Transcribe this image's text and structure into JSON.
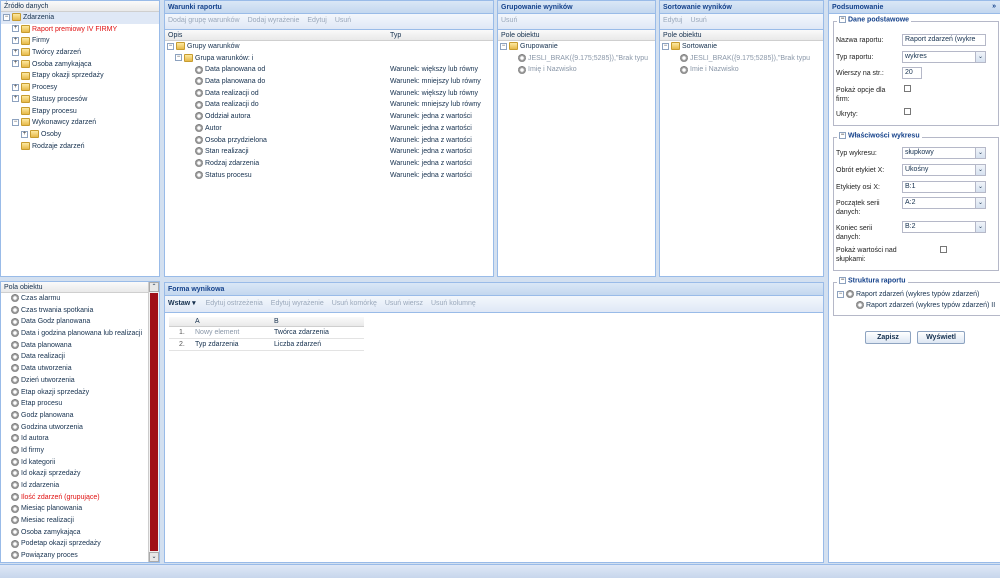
{
  "source": {
    "title": "Źródło danych",
    "items": [
      {
        "label": "Zdarzenia",
        "toggle": "−",
        "indent": 0,
        "selected": true
      },
      {
        "label": "Raport premiowy IV FIRMY",
        "toggle": "+",
        "indent": 1,
        "red": true
      },
      {
        "label": "Firmy",
        "toggle": "+",
        "indent": 1
      },
      {
        "label": "Twórcy zdarzeń",
        "toggle": "+",
        "indent": 1
      },
      {
        "label": "Osoba zamykająca",
        "toggle": "+",
        "indent": 1
      },
      {
        "label": "Etapy okazji sprzedaży",
        "toggle": "",
        "indent": 1
      },
      {
        "label": "Procesy",
        "toggle": "+",
        "indent": 1
      },
      {
        "label": "Statusy procesów",
        "toggle": "+",
        "indent": 1
      },
      {
        "label": "Etapy procesu",
        "toggle": "",
        "indent": 1
      },
      {
        "label": "Wykonawcy zdarzeń",
        "toggle": "−",
        "indent": 1
      },
      {
        "label": "Osoby",
        "toggle": "+",
        "indent": 2
      },
      {
        "label": "Rodzaje zdarzeń",
        "toggle": "",
        "indent": 1
      }
    ]
  },
  "fields": {
    "title": "Pola obiektu",
    "items": [
      {
        "label": "Czas alarmu"
      },
      {
        "label": "Czas trwania spotkania"
      },
      {
        "label": "Data Godz planowana"
      },
      {
        "label": "Data i godzina planowana lub realizacji"
      },
      {
        "label": "Data planowana"
      },
      {
        "label": "Data realizacji"
      },
      {
        "label": "Data utworzenia"
      },
      {
        "label": "Dzień utworzenia"
      },
      {
        "label": "Etap okazji sprzedaży"
      },
      {
        "label": "Etap procesu"
      },
      {
        "label": "Godz planowana"
      },
      {
        "label": "Godzina utworzenia"
      },
      {
        "label": "Id autora"
      },
      {
        "label": "Id firmy"
      },
      {
        "label": "Id kategorii"
      },
      {
        "label": "Id okazji sprzedaży"
      },
      {
        "label": "Id zdarzenia"
      },
      {
        "label": "Ilość zdarzeń (grupujące)",
        "red": true
      },
      {
        "label": "Miesiąc planowania"
      },
      {
        "label": "Miesiac realizacji"
      },
      {
        "label": "Osoba zamykająca"
      },
      {
        "label": "Podetap okazji sprzedaży"
      },
      {
        "label": "Powiązany proces"
      }
    ]
  },
  "conditions": {
    "title": "Warunki raportu",
    "toolbar": [
      "Dodaj grupę warunków",
      "Dodaj wyrażenie",
      "Edytuj",
      "Usuń"
    ],
    "col_desc": "Opis",
    "col_type": "Typ",
    "rows": [
      {
        "label": "Grupy warunków",
        "type": "",
        "indent": 0,
        "icon": "folder",
        "toggle": "−"
      },
      {
        "label": "Grupa warunków: i",
        "type": "",
        "indent": 1,
        "icon": "folder",
        "toggle": "−"
      },
      {
        "label": "Data planowana od",
        "type": "Warunek: większy lub równy",
        "indent": 2,
        "icon": "gear"
      },
      {
        "label": "Data planowana do",
        "type": "Warunek: mniejszy lub równy",
        "indent": 2,
        "icon": "gear"
      },
      {
        "label": "Data realizacji od",
        "type": "Warunek: większy lub równy",
        "indent": 2,
        "icon": "gear"
      },
      {
        "label": "Data realizacji do",
        "type": "Warunek: mniejszy lub równy",
        "indent": 2,
        "icon": "gear"
      },
      {
        "label": "Oddział autora",
        "type": "Warunek: jedna z wartości",
        "indent": 2,
        "icon": "gear"
      },
      {
        "label": "Autor",
        "type": "Warunek: jedna z wartości",
        "indent": 2,
        "icon": "gear"
      },
      {
        "label": "Osoba przydzielona",
        "type": "Warunek: jedna z wartości",
        "indent": 2,
        "icon": "gear"
      },
      {
        "label": "Stan realizacji",
        "type": "Warunek: jedna z wartości",
        "indent": 2,
        "icon": "gear"
      },
      {
        "label": "Rodzaj zdarzenia",
        "type": "Warunek: jedna z wartości",
        "indent": 2,
        "icon": "gear"
      },
      {
        "label": "Status procesu",
        "type": "Warunek: jedna z wartości",
        "indent": 2,
        "icon": "gear"
      }
    ]
  },
  "grouping": {
    "title": "Grupowanie wyników",
    "toolbar": [
      "Usuń"
    ],
    "col": "Pole obiektu",
    "rows": [
      {
        "label": "Grupowanie",
        "indent": 0,
        "icon": "folder",
        "toggle": "−"
      },
      {
        "label": "JESLI_BRAK({9.175;5285}),\"Brak typu",
        "indent": 1,
        "icon": "gear",
        "grey": true
      },
      {
        "label": "Imię i Nazwisko",
        "indent": 1,
        "icon": "gear",
        "grey": true
      }
    ]
  },
  "sorting": {
    "title": "Sortowanie wyników",
    "toolbar": [
      "Edytuj",
      "Usuń"
    ],
    "col": "Pole obiektu",
    "rows": [
      {
        "label": "Sortowanie",
        "indent": 0,
        "icon": "folder",
        "toggle": "−"
      },
      {
        "label": "JESLI_BRAK({9.175;5285}),\"Brak typu",
        "indent": 1,
        "icon": "gear",
        "grey": true
      },
      {
        "label": "Imie i Nazwisko",
        "indent": 1,
        "icon": "gear",
        "grey": true
      }
    ]
  },
  "result_form": {
    "title": "Forma wynikowa",
    "insert_label": "Wstaw",
    "toolbar": [
      "Edytuj ostrzeżenia",
      "Edytuj wyrażenie",
      "Usuń komórkę",
      "Usuń wiersz",
      "Usuń kolumnę"
    ],
    "col_a": "A",
    "col_b": "B",
    "rows": [
      {
        "num": "1.",
        "a": "Nowy element",
        "b": "Twórca zdarzenia",
        "a_grey": true
      },
      {
        "num": "2.",
        "a": "Typ zdarzenia",
        "b": "Liczba zdarzeń"
      }
    ]
  },
  "summary": {
    "title": "Podsumowanie",
    "collapse_icon": "»",
    "basic": {
      "legend": "Dane podstawowe",
      "name_label": "Nazwa raportu:",
      "name_value": "Raport zdarzeń (wykre",
      "type_label": "Typ raportu:",
      "type_value": "wykres",
      "rows_label": "Wierszy na str.:",
      "rows_value": "20",
      "show_opts_label": "Pokaż opcje dla firm:",
      "hidden_label": "Ukryty:"
    },
    "chart": {
      "legend": "Właściwości wykresu",
      "chart_type_label": "Typ wykresu:",
      "chart_type_value": "słupkowy",
      "rotation_label": "Obrót etykiet X:",
      "rotation_value": "Ukośny",
      "xlabels_label": "Etykiety osi X:",
      "xlabels_value": "B:1",
      "series_start_label": "Początek serii danych:",
      "series_start_value": "A:2",
      "series_end_label": "Koniec serii danych:",
      "series_end_value": "B:2",
      "show_values_label": "Pokaż wartości nad słupkami:"
    },
    "structure": {
      "legend": "Struktura raportu",
      "root": "Raport zdarzeń (wykres typów zdarzeń)",
      "child": "Raport zdarzeń (wykres typów zdarzeń) II"
    },
    "save_label": "Zapisz",
    "view_label": "Wyświetl"
  }
}
